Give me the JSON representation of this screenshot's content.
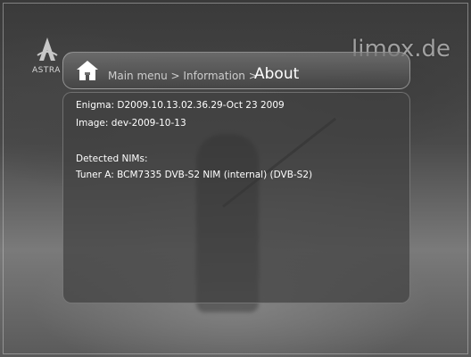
{
  "brand": "limox.de",
  "logo": {
    "text": "ASTRA"
  },
  "header": {
    "breadcrumb": "Main menu > Information >",
    "title": "About"
  },
  "info": {
    "enigma": "Enigma: D2009.10.13.02.36.29-Oct 23 2009",
    "image": "Image: dev-2009-10-13",
    "nims_heading": "Detected NIMs:",
    "tuner_a": "Tuner A: BCM7335 DVB-S2 NIM (internal) (DVB-S2)"
  },
  "colors": {
    "text": "#ffffff",
    "panel": "#414141",
    "header": "#6e6e6e"
  }
}
